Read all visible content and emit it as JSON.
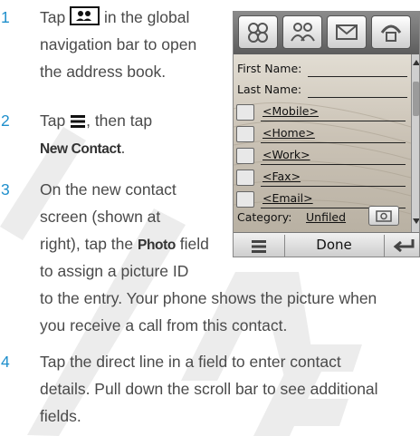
{
  "steps": [
    {
      "num": "1",
      "lines": [
        "Tap",
        "in the global",
        "navigation bar to open",
        "the address book."
      ]
    },
    {
      "num": "2",
      "lines": [
        "Tap",
        ", then tap",
        "New Contact",
        "."
      ]
    },
    {
      "num": "3",
      "lines": [
        "On the new contact",
        "screen (shown at",
        "right), tap the",
        "Photo",
        "field",
        "to assign a picture ID",
        "to the entry. Your phone shows the picture when",
        "you receive a call from this contact."
      ]
    },
    {
      "num": "4",
      "lines": [
        "Tap the direct line in a field to enter contact",
        "details. Pull down the scroll bar to see additional",
        "fields."
      ]
    }
  ],
  "phone": {
    "top_icons": [
      "contacts-icon",
      "group-icon",
      "message-icon",
      "phone-icon"
    ],
    "fields": {
      "first_name": "First Name:",
      "last_name": "Last Name:",
      "mobile": "<Mobile>",
      "home": "<Home>",
      "work": "<Work>",
      "fax": "<Fax>",
      "email": "<Email>",
      "category": "Category:",
      "category_value": "Unfiled"
    },
    "bottom": {
      "done_label": "Done"
    }
  },
  "colors": {
    "accent": "#1f8fcc",
    "text": "#4a4a4a"
  }
}
